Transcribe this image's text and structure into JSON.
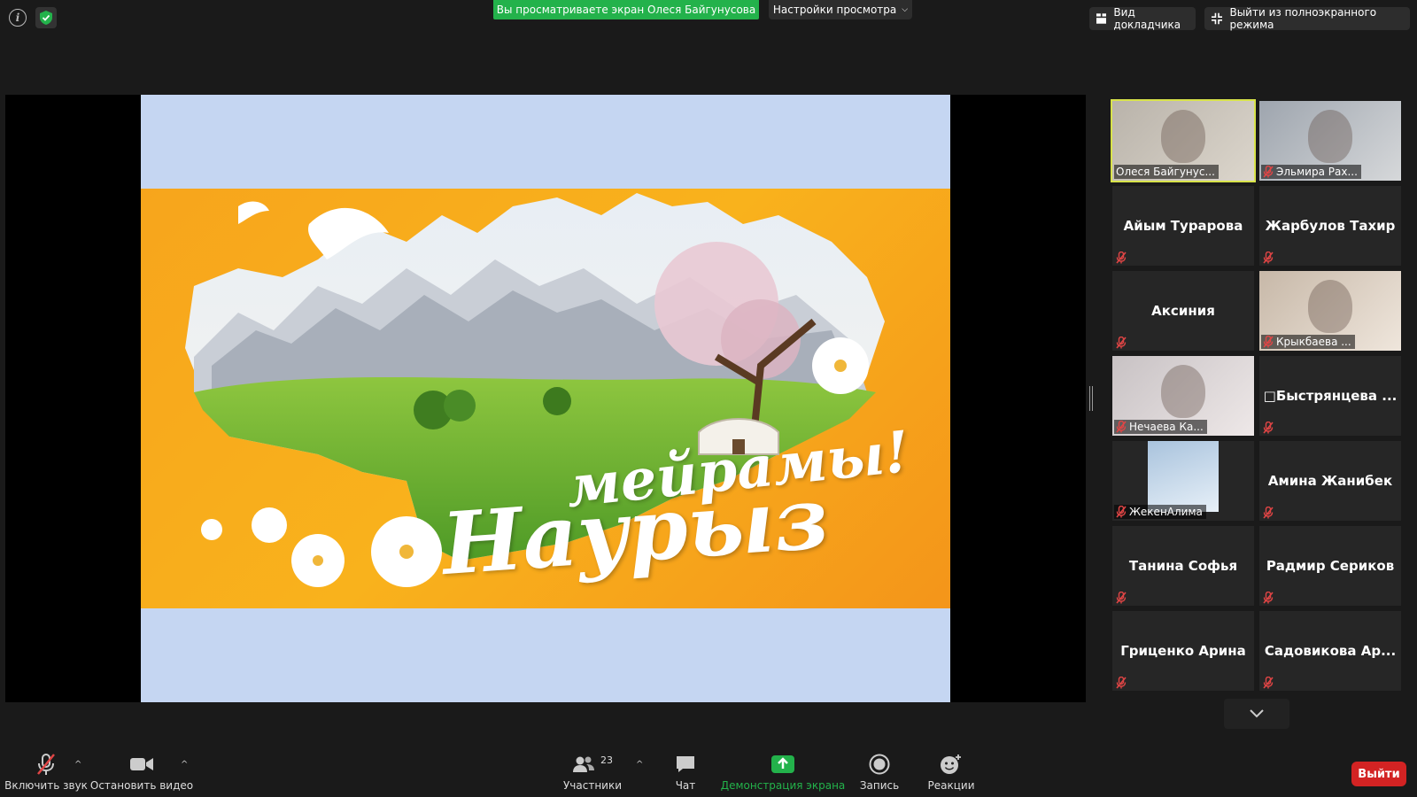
{
  "top": {
    "viewing_banner": "Вы просматриваете экран Олеся Байгунусова",
    "view_settings": "Настройки просмотра",
    "speaker_view": "Вид докладчика",
    "exit_fullscreen": "Выйти из полноэкранного режима"
  },
  "slide": {
    "line1": "мейрамы!",
    "line2": "Наурыз"
  },
  "participants": [
    {
      "name": "Олеся Байгунус...",
      "video": true,
      "muted": false
    },
    {
      "name": "Эльмира Рах...",
      "video": true,
      "muted": true
    },
    {
      "name": "Айым Турарова",
      "video": false,
      "muted": true
    },
    {
      "name": "Жарбулов Тахир",
      "video": false,
      "muted": true
    },
    {
      "name": "Аксиния",
      "video": false,
      "muted": true
    },
    {
      "name": "Крыкбаева ...",
      "video": true,
      "muted": true
    },
    {
      "name": "Нечаева Ка...",
      "video": true,
      "muted": true
    },
    {
      "name": "□Быстрянцева ...",
      "video": false,
      "muted": true
    },
    {
      "name": "ЖекенАлима",
      "video": true,
      "muted": true
    },
    {
      "name": "Амина Жанибек",
      "video": false,
      "muted": true
    },
    {
      "name": "Танина Софья",
      "video": false,
      "muted": true
    },
    {
      "name": "Радмир Сериков",
      "video": false,
      "muted": true
    },
    {
      "name": "Гриценко Арина",
      "video": false,
      "muted": true
    },
    {
      "name": "Садовикова  Ар...",
      "video": false,
      "muted": true
    }
  ],
  "toolbar": {
    "unmute": "Включить звук",
    "stop_video": "Остановить видео",
    "participants": "Участники",
    "participants_count": "23",
    "chat": "Чат",
    "share_screen": "Демонстрация экрана",
    "record": "Запись",
    "reactions": "Реакции",
    "leave": "Выйти"
  },
  "colors": {
    "share_green": "#23b24b",
    "active_speaker": "#d8e34a",
    "muted_red": "#e04545",
    "leave_red": "#d32323",
    "slide_orange": "#f7a51c",
    "slide_blue": "#c5d6f2"
  },
  "icons": {
    "info": "info-icon",
    "security": "shield-icon",
    "mic_off": "mic-off-icon",
    "video": "video-camera-icon",
    "participants": "people-icon",
    "chat": "chat-bubble-icon",
    "share": "share-screen-icon",
    "record": "record-icon",
    "reactions": "emoji-plus-icon"
  }
}
